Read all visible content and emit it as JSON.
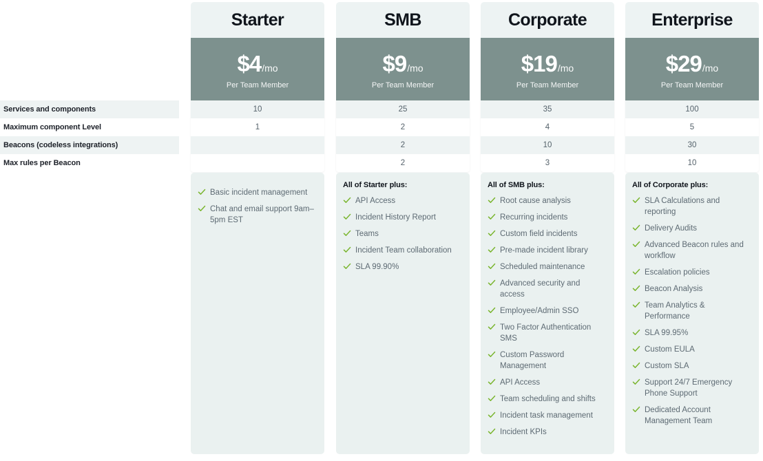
{
  "theme": {
    "price_band_color": "#7d918e",
    "panel_bg": "#eaf1f0",
    "row_tint": "#eef3f3",
    "check_color": "#7ab52e",
    "heading_color": "#10151c",
    "text_color": "#5d6a73"
  },
  "comparison": {
    "row_labels": [
      "Services and components",
      "Maximum component Level",
      "Beacons (codeless integrations)",
      "Max rules per Beacon"
    ]
  },
  "plans": [
    {
      "name": "Starter",
      "price": "$4",
      "period": "/mo",
      "price_sub": "Per Team Member",
      "values": [
        "10",
        "1",
        "",
        ""
      ],
      "features_heading": "",
      "features": [
        "Basic incident management",
        "Chat and email support 9am–5pm EST"
      ]
    },
    {
      "name": "SMB",
      "price": "$9",
      "period": "/mo",
      "price_sub": "Per Team Member",
      "values": [
        "25",
        "2",
        "2",
        "2"
      ],
      "features_heading": "All of Starter plus:",
      "features": [
        "API Access",
        "Incident History Report",
        "Teams",
        "Incident Team collaboration",
        "SLA 99.90%"
      ]
    },
    {
      "name": "Corporate",
      "price": "$19",
      "period": "/mo",
      "price_sub": "Per Team Member",
      "values": [
        "35",
        "4",
        "10",
        "3"
      ],
      "features_heading": "All of SMB plus:",
      "features": [
        "Root cause analysis",
        "Recurring incidents",
        "Custom field incidents",
        "Pre-made incident library",
        "Scheduled maintenance",
        "Advanced security and access",
        "Employee/Admin SSO",
        "Two Factor Authentication SMS",
        "Custom Password Management",
        "API Access",
        "Team scheduling and shifts",
        "Incident task management",
        "Incident KPIs"
      ]
    },
    {
      "name": "Enterprise",
      "price": "$29",
      "period": "/mo",
      "price_sub": "Per Team Member",
      "values": [
        "100",
        "5",
        "30",
        "10"
      ],
      "features_heading": "All of Corporate plus:",
      "features": [
        "SLA Calculations and reporting",
        "Delivery Audits",
        "Advanced Beacon rules and workflow",
        "Escalation policies",
        "Beacon Analysis",
        "Team Analytics & Performance",
        "SLA 99.95%",
        "Custom EULA",
        "Custom SLA",
        "Support 24/7 Emergency Phone Support",
        "Dedicated Account Management Team"
      ]
    }
  ],
  "icons": {
    "check": "check-icon"
  }
}
